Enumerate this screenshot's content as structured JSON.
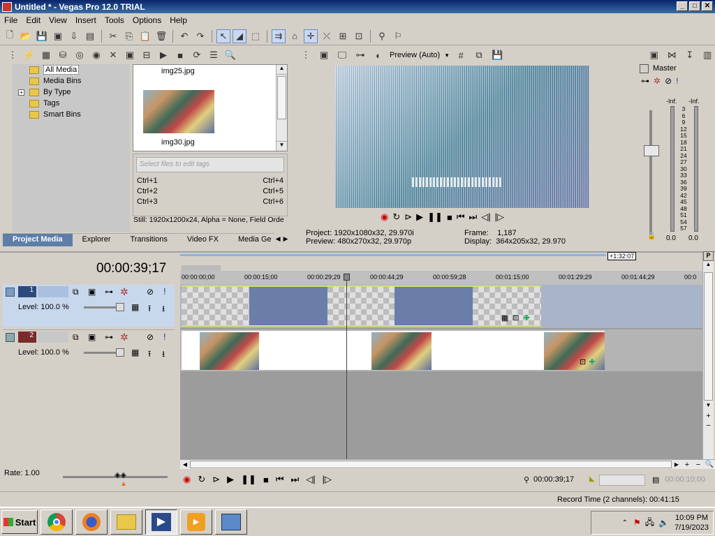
{
  "window": {
    "title": "Untitled * - Vegas Pro 12.0 TRIAL",
    "minimize": "_",
    "maximize": "□",
    "close": "✕"
  },
  "menu": [
    "File",
    "Edit",
    "View",
    "Insert",
    "Tools",
    "Options",
    "Help"
  ],
  "media_tree": [
    "All Media",
    "Media Bins",
    "By Type",
    "Tags",
    "Smart Bins"
  ],
  "files": {
    "file1": "img25.jpg",
    "file2": "img30.jpg"
  },
  "tags_placeholder": "Select files to edit tags",
  "shortcuts": [
    [
      "Ctrl+1",
      "Ctrl+4"
    ],
    [
      "Ctrl+2",
      "Ctrl+5"
    ],
    [
      "Ctrl+3",
      "Ctrl+6"
    ]
  ],
  "still_info": "Still: 1920x1200x24, Alpha = None, Field Orde",
  "tabs": [
    "Project Media",
    "Explorer",
    "Transitions",
    "Video FX",
    "Media Ge"
  ],
  "preview": {
    "mode": "Preview (Auto)",
    "project_label": "Project:",
    "project_value": "1920x1080x32, 29.970i",
    "preview_label": "Preview:",
    "preview_value": "480x270x32, 29.970p",
    "frame_label": "Frame:",
    "frame_value": "1,187",
    "display_label": "Display:",
    "display_value": "364x205x32, 29.970"
  },
  "master": {
    "title": "Master",
    "left_peak": "-Inf.",
    "right_peak": "-Inf.",
    "scale": [
      "3",
      "6",
      "9",
      "12",
      "15",
      "18",
      "21",
      "24",
      "27",
      "30",
      "33",
      "36",
      "39",
      "42",
      "45",
      "48",
      "51",
      "54",
      "57"
    ],
    "left_value": "0.0",
    "right_value": "0.0"
  },
  "timeline": {
    "timecode": "00:00:39;17",
    "duration_badge": "+1:32:07",
    "ruler": [
      "00:00:00;00",
      "00:00:15;00",
      "00:00:29;29",
      "00:00:44;29",
      "00:00:59;28",
      "00:01:15;00",
      "00:01:29;29",
      "00:01:44;29",
      "00:0"
    ],
    "rate": "Rate: 1.00"
  },
  "tracks": [
    {
      "number": "1",
      "level": "Level: 100.0 %"
    },
    {
      "number": "2",
      "level": "Level: 100.0 %"
    }
  ],
  "transport": {
    "cursor_time": "00:00:39;17",
    "end_time": "00:00:10;00"
  },
  "status": "Record Time (2 channels): 00:41:15",
  "taskbar": {
    "start": "Start",
    "time": "10:09 PM",
    "date": "7/19/2023"
  }
}
